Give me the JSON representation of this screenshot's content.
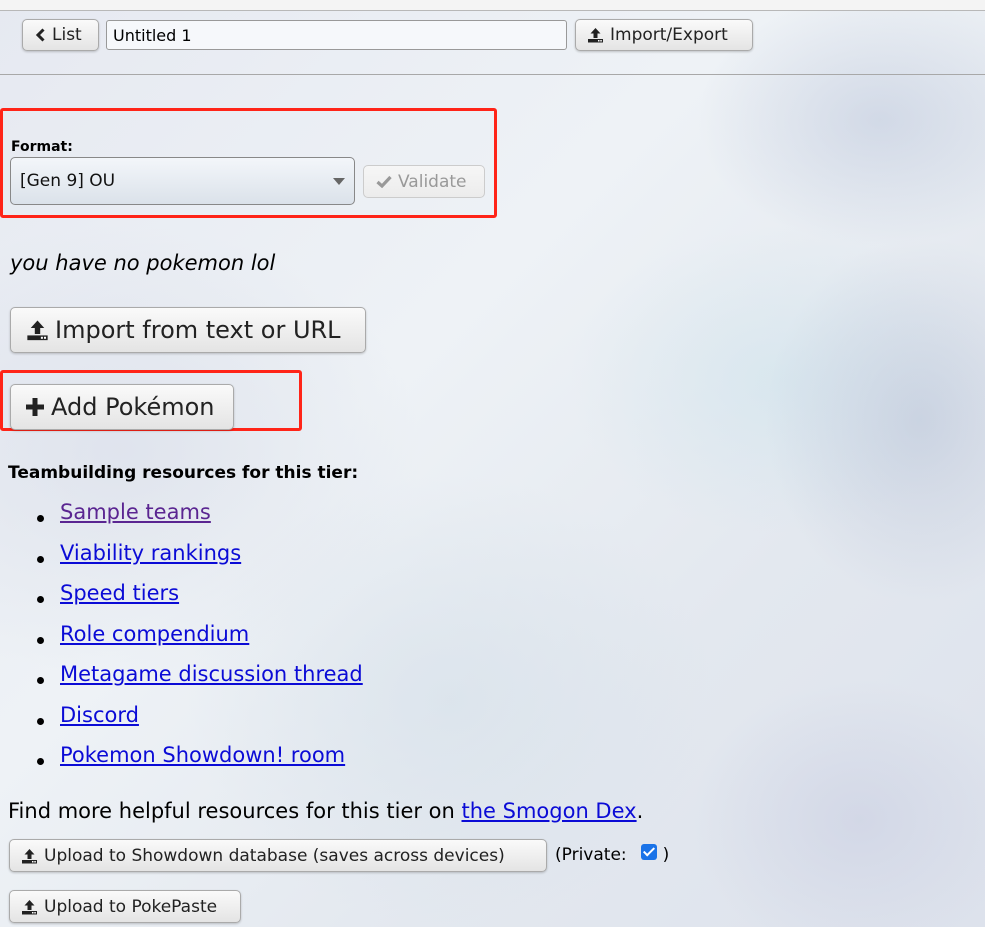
{
  "toolbar": {
    "list_label": "List",
    "team_name": "Untitled 1",
    "import_export_label": "Import/Export"
  },
  "format": {
    "label": "Format:",
    "selected": "[Gen 9] OU",
    "validate_label": "Validate"
  },
  "team": {
    "empty_message": "you have no pokemon lol",
    "import_label": "Import from text or URL",
    "add_label": "Add Pokémon"
  },
  "resources": {
    "heading": "Teambuilding resources for this tier:",
    "links": [
      {
        "label": "Sample teams",
        "visited": true
      },
      {
        "label": "Viability rankings",
        "visited": false
      },
      {
        "label": "Speed tiers",
        "visited": false
      },
      {
        "label": "Role compendium",
        "visited": false
      },
      {
        "label": "Metagame discussion thread",
        "visited": false
      },
      {
        "label": "Discord",
        "visited": false
      },
      {
        "label": "Pokemon Showdown! room",
        "visited": false
      }
    ],
    "find_more_prefix": "Find more helpful resources for this tier on ",
    "find_more_link": "the Smogon Dex",
    "find_more_suffix": "."
  },
  "upload": {
    "database_label": "Upload to Showdown database (saves across devices)",
    "private_prefix": "(Private:",
    "private_checked": true,
    "private_suffix": ")",
    "pokepaste_label": "Upload to PokePaste"
  },
  "colors": {
    "link": "#0b0bd6",
    "visited_link": "#5a2591",
    "highlight_box": "#ff2418",
    "checkbox": "#1a73e8"
  }
}
